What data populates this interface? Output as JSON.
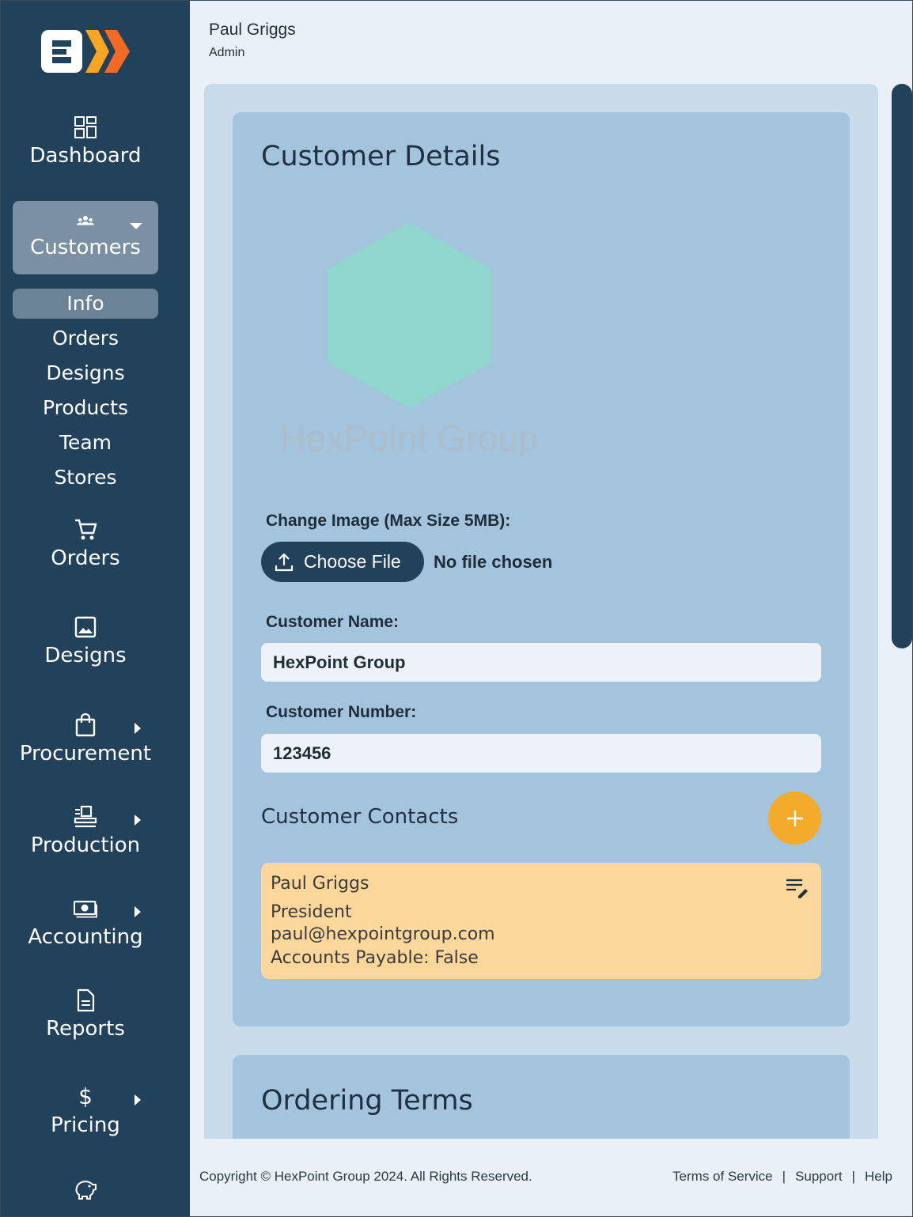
{
  "header": {
    "user_name": "Paul Griggs",
    "user_role": "Admin"
  },
  "sidebar": {
    "items": [
      {
        "label": "Dashboard",
        "icon": "dashboard-icon"
      },
      {
        "label": "Customers",
        "icon": "users-icon",
        "expanded": true
      },
      {
        "label": "Orders",
        "icon": "cart-icon"
      },
      {
        "label": "Designs",
        "icon": "image-icon"
      },
      {
        "label": "Procurement",
        "icon": "bag-icon"
      },
      {
        "label": "Production",
        "icon": "production-icon"
      },
      {
        "label": "Accounting",
        "icon": "cash-icon"
      },
      {
        "label": "Reports",
        "icon": "document-icon"
      },
      {
        "label": "Pricing",
        "icon": "dollar-icon"
      },
      {
        "label": "",
        "icon": "piggy-bank-icon"
      }
    ],
    "customers_sub": [
      "Info",
      "Orders",
      "Designs",
      "Products",
      "Team",
      "Stores"
    ],
    "active_sub": "Info"
  },
  "customer_details": {
    "title": "Customer Details",
    "logo_text": "HexPoint Group",
    "change_image_label": "Change Image (Max Size 5MB):",
    "choose_file_label": "Choose File",
    "no_file_text": "No file chosen",
    "name_label": "Customer Name:",
    "name_value": "HexPoint Group",
    "number_label": "Customer Number:",
    "number_value": "123456",
    "contacts_title": "Customer Contacts",
    "contacts": [
      {
        "name": "Paul Griggs",
        "title": "President",
        "email": "paul@hexpointgroup.com",
        "accounts_payable": "Accounts Payable: False"
      }
    ]
  },
  "ordering_terms": {
    "title": "Ordering Terms"
  },
  "footer": {
    "copyright": "Copyright © HexPoint Group 2024. All Rights Reserved.",
    "links": [
      "Terms of Service",
      "Support",
      "Help"
    ]
  },
  "colors": {
    "sidebar": "#22415a",
    "accent_orange": "#f4aa2a",
    "card_blue": "#a4c3dd",
    "contact_card": "#fbd79c",
    "logo_hex": "#8fd6cc"
  }
}
